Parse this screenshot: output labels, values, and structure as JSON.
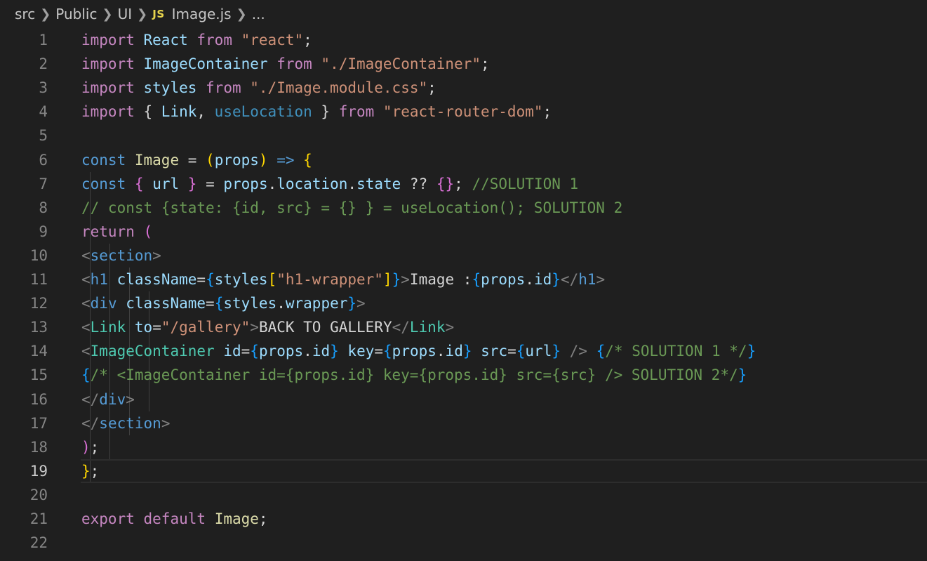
{
  "breadcrumb": {
    "items": [
      "src",
      "Public",
      "UI"
    ],
    "file_badge": "JS",
    "file_name": "Image.js",
    "overflow": "..."
  },
  "editor": {
    "line_numbers": [
      "1",
      "2",
      "3",
      "4",
      "5",
      "6",
      "7",
      "8",
      "9",
      "10",
      "11",
      "12",
      "13",
      "14",
      "15",
      "16",
      "17",
      "18",
      "19",
      "20",
      "21",
      "22"
    ],
    "active_line": 19,
    "lines": [
      [
        [
          "kw",
          "import"
        ],
        [
          "punc",
          " "
        ],
        [
          "var",
          "React"
        ],
        [
          "punc",
          " "
        ],
        [
          "kw",
          "from"
        ],
        [
          "punc",
          " "
        ],
        [
          "str",
          "\"react\""
        ],
        [
          "punc",
          ";"
        ]
      ],
      [
        [
          "kw",
          "import"
        ],
        [
          "punc",
          " "
        ],
        [
          "var",
          "ImageContainer"
        ],
        [
          "punc",
          " "
        ],
        [
          "kw",
          "from"
        ],
        [
          "punc",
          " "
        ],
        [
          "str",
          "\"./ImageContainer\""
        ],
        [
          "punc",
          ";"
        ]
      ],
      [
        [
          "kw",
          "import"
        ],
        [
          "punc",
          " "
        ],
        [
          "var",
          "styles"
        ],
        [
          "punc",
          " "
        ],
        [
          "kw",
          "from"
        ],
        [
          "punc",
          " "
        ],
        [
          "str",
          "\"./Image.module.css\""
        ],
        [
          "punc",
          ";"
        ]
      ],
      [
        [
          "kw",
          "import"
        ],
        [
          "punc",
          " { "
        ],
        [
          "var",
          "Link"
        ],
        [
          "punc",
          ", "
        ],
        [
          "faded",
          "useLocation"
        ],
        [
          "punc",
          " } "
        ],
        [
          "kw",
          "from"
        ],
        [
          "punc",
          " "
        ],
        [
          "str",
          "\"react-router-dom\""
        ],
        [
          "punc",
          ";"
        ]
      ],
      [],
      [
        [
          "dk",
          "const"
        ],
        [
          "punc",
          " "
        ],
        [
          "fn",
          "Image"
        ],
        [
          "punc",
          " = "
        ],
        [
          "br1",
          "("
        ],
        [
          "var",
          "props"
        ],
        [
          "br1",
          ")"
        ],
        [
          "punc",
          " "
        ],
        [
          "dk",
          "=>"
        ],
        [
          "punc",
          " "
        ],
        [
          "br1",
          "{"
        ]
      ],
      [
        [
          "punc",
          "  "
        ],
        [
          "dk",
          "const"
        ],
        [
          "punc",
          " "
        ],
        [
          "br2",
          "{"
        ],
        [
          "punc",
          " "
        ],
        [
          "var",
          "url"
        ],
        [
          "punc",
          " "
        ],
        [
          "br2",
          "}"
        ],
        [
          "punc",
          " = "
        ],
        [
          "var",
          "props"
        ],
        [
          "punc",
          "."
        ],
        [
          "var",
          "location"
        ],
        [
          "punc",
          "."
        ],
        [
          "var",
          "state"
        ],
        [
          "punc",
          " ?? "
        ],
        [
          "br2",
          "{}"
        ],
        [
          "punc",
          "; "
        ],
        [
          "cmt",
          "//SOLUTION 1"
        ]
      ],
      [
        [
          "punc",
          "  "
        ],
        [
          "cmt",
          "// const {state: {id, src} = {} } = useLocation(); SOLUTION 2"
        ]
      ],
      [
        [
          "punc",
          "  "
        ],
        [
          "kw",
          "return"
        ],
        [
          "punc",
          " "
        ],
        [
          "br2",
          "("
        ]
      ],
      [
        [
          "punc",
          "    "
        ],
        [
          "gry",
          "<"
        ],
        [
          "tag",
          "section"
        ],
        [
          "gry",
          ">"
        ]
      ],
      [
        [
          "punc",
          "      "
        ],
        [
          "gry",
          "<"
        ],
        [
          "tag",
          "h1"
        ],
        [
          "punc",
          " "
        ],
        [
          "var",
          "className"
        ],
        [
          "punc",
          "="
        ],
        [
          "br3",
          "{"
        ],
        [
          "var",
          "styles"
        ],
        [
          "br1",
          "["
        ],
        [
          "str",
          "\"h1-wrapper\""
        ],
        [
          "br1",
          "]"
        ],
        [
          "br3",
          "}"
        ],
        [
          "gry",
          ">"
        ],
        [
          "punc",
          "Image :"
        ],
        [
          "br3",
          "{"
        ],
        [
          "var",
          "props"
        ],
        [
          "punc",
          "."
        ],
        [
          "var",
          "id"
        ],
        [
          "br3",
          "}"
        ],
        [
          "gry",
          "</"
        ],
        [
          "tag",
          "h1"
        ],
        [
          "gry",
          ">"
        ]
      ],
      [
        [
          "punc",
          "      "
        ],
        [
          "gry",
          "<"
        ],
        [
          "tag",
          "div"
        ],
        [
          "punc",
          " "
        ],
        [
          "var",
          "className"
        ],
        [
          "punc",
          "="
        ],
        [
          "br3",
          "{"
        ],
        [
          "var",
          "styles"
        ],
        [
          "punc",
          "."
        ],
        [
          "var",
          "wrapper"
        ],
        [
          "br3",
          "}"
        ],
        [
          "gry",
          ">"
        ]
      ],
      [
        [
          "punc",
          "        "
        ],
        [
          "gry",
          "<"
        ],
        [
          "cls",
          "Link"
        ],
        [
          "punc",
          " "
        ],
        [
          "var",
          "to"
        ],
        [
          "punc",
          "="
        ],
        [
          "str",
          "\"/gallery\""
        ],
        [
          "gry",
          ">"
        ],
        [
          "punc",
          "BACK TO GALLERY"
        ],
        [
          "gry",
          "</"
        ],
        [
          "cls",
          "Link"
        ],
        [
          "gry",
          ">"
        ]
      ],
      [
        [
          "punc",
          "        "
        ],
        [
          "gry",
          "<"
        ],
        [
          "cls",
          "ImageContainer"
        ],
        [
          "punc",
          " "
        ],
        [
          "var",
          "id"
        ],
        [
          "punc",
          "="
        ],
        [
          "br3",
          "{"
        ],
        [
          "var",
          "props"
        ],
        [
          "punc",
          "."
        ],
        [
          "var",
          "id"
        ],
        [
          "br3",
          "}"
        ],
        [
          "punc",
          " "
        ],
        [
          "var",
          "key"
        ],
        [
          "punc",
          "="
        ],
        [
          "br3",
          "{"
        ],
        [
          "var",
          "props"
        ],
        [
          "punc",
          "."
        ],
        [
          "var",
          "id"
        ],
        [
          "br3",
          "}"
        ],
        [
          "punc",
          " "
        ],
        [
          "var",
          "src"
        ],
        [
          "punc",
          "="
        ],
        [
          "br3",
          "{"
        ],
        [
          "var",
          "url"
        ],
        [
          "br3",
          "}"
        ],
        [
          "punc",
          " "
        ],
        [
          "gry",
          "/>"
        ],
        [
          "punc",
          " "
        ],
        [
          "br3",
          "{"
        ],
        [
          "cmt",
          "/* SOLUTION 1 */"
        ],
        [
          "br3",
          "}"
        ]
      ],
      [
        [
          "punc",
          "        "
        ],
        [
          "br3",
          "{"
        ],
        [
          "cmt",
          "/* <ImageContainer id={props.id} key={props.id} src={src} />  SOLUTION 2*/"
        ],
        [
          "br3",
          "}"
        ]
      ],
      [
        [
          "punc",
          "      "
        ],
        [
          "gry",
          "</"
        ],
        [
          "tag",
          "div"
        ],
        [
          "gry",
          ">"
        ]
      ],
      [
        [
          "punc",
          "    "
        ],
        [
          "gry",
          "</"
        ],
        [
          "tag",
          "section"
        ],
        [
          "gry",
          ">"
        ]
      ],
      [
        [
          "punc",
          "  "
        ],
        [
          "br2",
          ")"
        ],
        [
          "punc",
          ";"
        ]
      ],
      [
        [
          "br1",
          "}"
        ],
        [
          "punc",
          ";"
        ]
      ],
      [],
      [
        [
          "kw",
          "export"
        ],
        [
          "punc",
          " "
        ],
        [
          "kw",
          "default"
        ],
        [
          "punc",
          " "
        ],
        [
          "fn",
          "Image"
        ],
        [
          "punc",
          ";"
        ]
      ],
      []
    ]
  }
}
